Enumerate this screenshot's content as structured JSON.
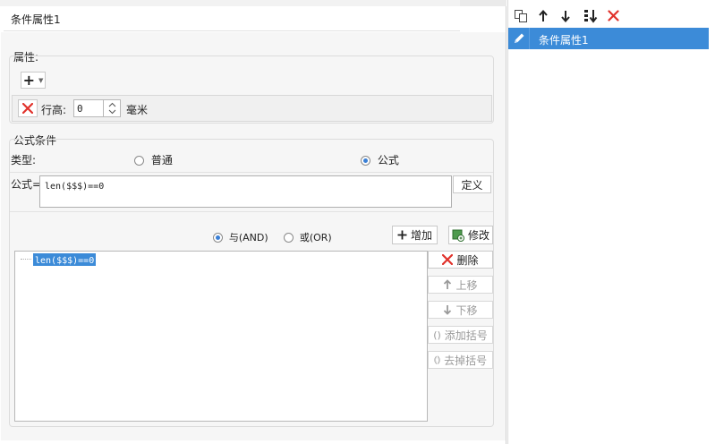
{
  "panel": {
    "title": "条件属性1"
  },
  "attributes": {
    "section_label": "属性:",
    "add_symbol": "+",
    "row_height_label": "行高:",
    "row_height_value": "0",
    "unit_label": "毫米"
  },
  "formula_condition": {
    "section_label": "公式条件",
    "type_label": "类型:",
    "type_options": [
      {
        "label": "普通",
        "selected": false
      },
      {
        "label": "公式",
        "selected": true
      }
    ],
    "formula_label": "公式=",
    "formula_value": "len($$$)==0",
    "define_button": "定义",
    "logic_options": [
      {
        "label": "与(AND)",
        "selected": true
      },
      {
        "label": "或(OR)",
        "selected": false
      }
    ],
    "add_button": "增加",
    "modify_button": "修改",
    "conditions": [
      "len($$$)==0"
    ],
    "delete_button": "删除",
    "move_up_button": "上移",
    "move_down_button": "下移",
    "add_bracket_button": "添加括号",
    "remove_bracket_button": "去掉括号"
  },
  "right_panel": {
    "items": [
      {
        "label": "条件属性1",
        "selected": true
      }
    ]
  },
  "colors": {
    "selection_blue": "#3c8bd8",
    "delete_red": "#e0322b",
    "accent_blue": "#3a7fd5"
  }
}
